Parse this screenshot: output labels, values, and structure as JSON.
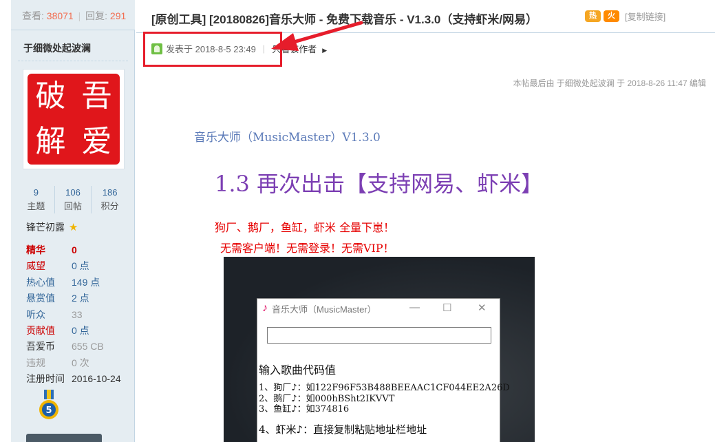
{
  "sidebar": {
    "views_label": "查看:",
    "views_value": "38071",
    "replies_label": "回复:",
    "replies_value": "291",
    "username": "于细微处起波澜",
    "avatar_chars": [
      "破",
      "吾",
      "解",
      "爱"
    ],
    "counts": [
      {
        "value": "9",
        "label": "主题"
      },
      {
        "value": "106",
        "label": "回帖"
      },
      {
        "value": "186",
        "label": "积分"
      }
    ],
    "rank_title": "锋芒初露",
    "info": [
      {
        "key": "精华",
        "value": "0"
      },
      {
        "key": "威望",
        "value": "0 点"
      },
      {
        "key": "热心值",
        "value": "149 点"
      },
      {
        "key": "悬赏值",
        "value": "2 点"
      },
      {
        "key": "听众",
        "value": "33"
      },
      {
        "key": "贡献值",
        "value": "0 点"
      },
      {
        "key": "吾爱币",
        "value": "655 CB"
      },
      {
        "key": "违规",
        "value": "0 次"
      },
      {
        "key": "注册时间",
        "value": "2016-10-24"
      }
    ],
    "medal_number": "5"
  },
  "header": {
    "title": "[原创工具] [20180826]音乐大师 - 免费下载音乐 - V1.3.0（支持虾米/网易）",
    "hot_icon_text": "热",
    "fire_icon_text": "火",
    "copy_link": "[复制链接]"
  },
  "post": {
    "posted_at": "发表于 2018-8-5 23:49",
    "only_author": "只看该作者",
    "edit_note": "本帖最后由 于细微处起波澜 于 2018-8-26 11:47 编辑",
    "title_small": "音乐大师（MusicMaster）V1.3.0",
    "title_big": "1.3 再次出击【支持网易、虾米】",
    "line1": "狗厂、鹅厂，鱼缸，虾米 全量下崽！",
    "line2": "无需客户端！无需登录！无需VIP！"
  },
  "app_window": {
    "title": "音乐大师（MusicMaster）",
    "minimize": "—",
    "maximize": "☐",
    "close": "✕",
    "input_label": "输入歌曲代码值",
    "items": [
      "1、狗厂♪：如122F96F53B488BEEAAC1CF044EE2A26D",
      "2、鹅厂♪：如000hBSht2IKVVT",
      "3、鱼缸♪：如374816",
      "4、虾米♪：直接复制粘贴地址栏地址"
    ]
  },
  "colors": {
    "sidebar_bg": "#e5edf2",
    "highlight_box": "#e61d2b",
    "title_purple": "#7c3fb3",
    "red_text": "#e60000",
    "link_blue": "#336699"
  }
}
